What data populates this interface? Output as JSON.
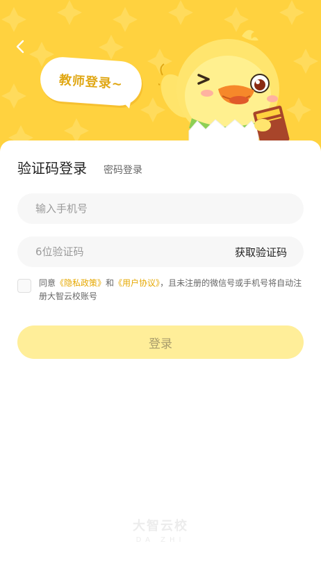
{
  "header": {
    "bubble_text": "教师登录~"
  },
  "tabs": {
    "active": "验证码登录",
    "inactive": "密码登录"
  },
  "phone_input": {
    "placeholder": "输入手机号",
    "value": ""
  },
  "code_input": {
    "placeholder": "6位验证码",
    "value": "",
    "get_code_label": "获取验证码"
  },
  "agreement": {
    "checked": false,
    "prefix": "同意",
    "privacy_link": "《隐私政策》",
    "and": "和",
    "user_link": "《用户协议》",
    "suffix": "，且未注册的微信号或手机号将自动注册大智云校账号"
  },
  "login_button": {
    "label": "登录"
  },
  "brand": {
    "name_cn": "大智云校",
    "name_en": "DA ZHI"
  },
  "colors": {
    "banner": "#ffd23f",
    "accent": "#e6a800",
    "login_button_disabled": "#ffee99"
  },
  "icons": {
    "back": "chevron-left-icon",
    "mascot": "duck-mascot-icon"
  }
}
